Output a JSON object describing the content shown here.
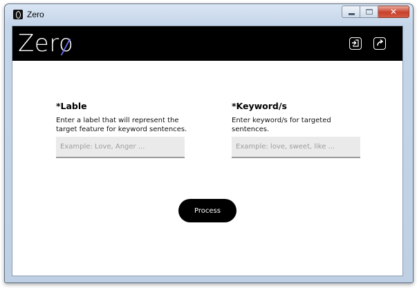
{
  "window": {
    "title": "Zero",
    "controls": {
      "minimize": "minimize",
      "maximize": "maximize",
      "close": "✕"
    }
  },
  "header": {
    "logo": "Zero",
    "icons": [
      "import-icon",
      "export-icon"
    ]
  },
  "form": {
    "label_field": {
      "heading": "*Lable",
      "description": "Enter a label that will represent the target feature for keyword sentences.",
      "placeholder": "Example: Love, Anger ...",
      "value": ""
    },
    "keyword_field": {
      "heading": "*Keyword/s",
      "description": "Enter keyword/s for targeted sentences.",
      "placeholder": "Example: love, sweet, like ...",
      "value": ""
    },
    "process_label": "Process"
  },
  "colors": {
    "header_bg": "#000000",
    "logo_accent": "#6e6ff5",
    "input_bg": "#eaeaea",
    "button_bg": "#000000"
  }
}
